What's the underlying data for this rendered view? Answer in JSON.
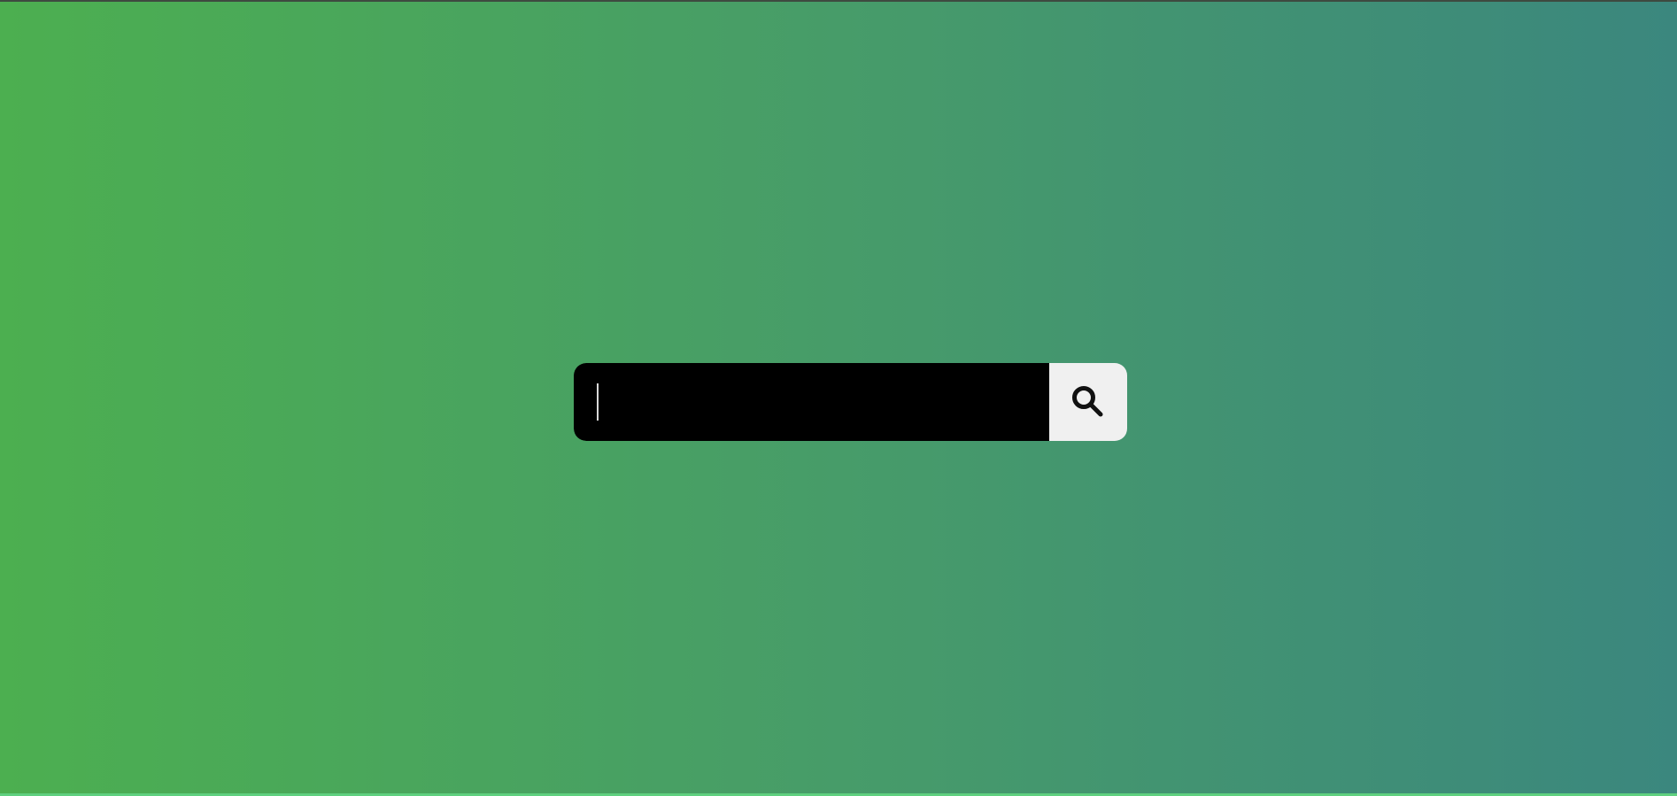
{
  "search": {
    "value": "",
    "placeholder": "",
    "button_icon": "search-icon"
  },
  "colors": {
    "gradient_start": "#4caf50",
    "gradient_end": "#3b877e",
    "input_background": "#000000",
    "button_background": "#f0f0f0"
  }
}
